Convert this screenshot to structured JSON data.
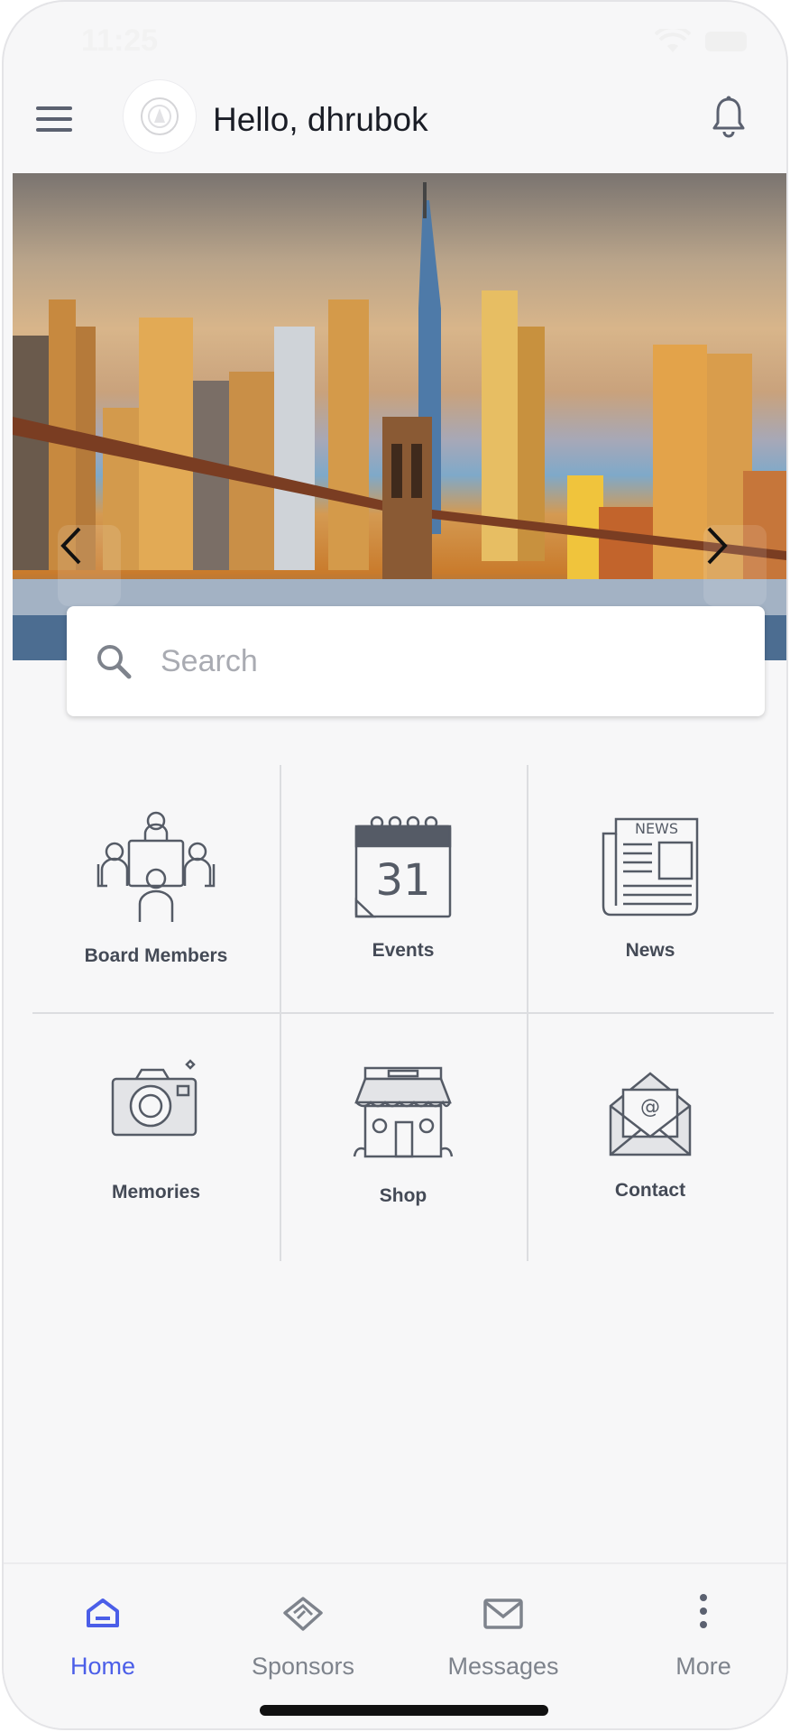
{
  "status_bar": {
    "time": "11:25"
  },
  "header": {
    "greeting": "Hello, dhrubok"
  },
  "search": {
    "placeholder": "Search"
  },
  "tiles": [
    {
      "label": "Board Members",
      "icon": "board-members-icon"
    },
    {
      "label": "Events",
      "icon": "calendar-icon",
      "calendar_day": "31"
    },
    {
      "label": "News",
      "icon": "newspaper-icon",
      "news_text": "NEWS"
    },
    {
      "label": "Memories",
      "icon": "camera-icon"
    },
    {
      "label": "Shop",
      "icon": "shop-icon"
    },
    {
      "label": "Contact",
      "icon": "envelope-icon",
      "email_symbol": "@"
    }
  ],
  "bottom_nav": {
    "items": [
      {
        "label": "Home",
        "icon": "home-icon",
        "active": true
      },
      {
        "label": "Sponsors",
        "icon": "handshake-icon",
        "active": false
      },
      {
        "label": "Messages",
        "icon": "mail-icon",
        "active": false
      },
      {
        "label": "More",
        "icon": "more-vertical-icon",
        "active": false
      }
    ]
  },
  "colors": {
    "accent": "#4b5ee8",
    "icon_gray": "#5b6170",
    "background": "#f7f7f8"
  }
}
